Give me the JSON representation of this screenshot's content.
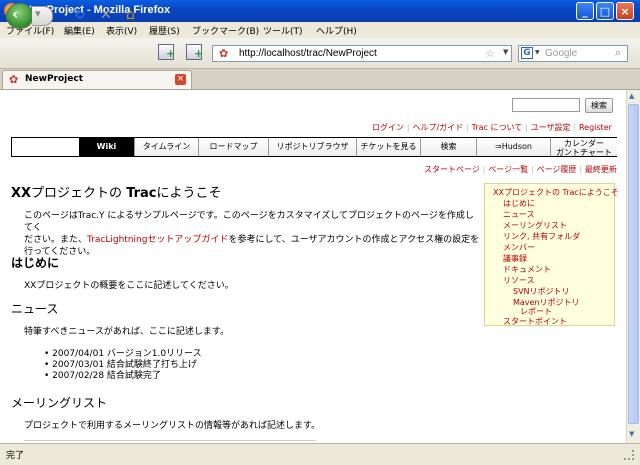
{
  "window": {
    "title": "NewProject - Mozilla Firefox",
    "minimize": "_",
    "maximize": "□",
    "close": "×"
  },
  "menu": [
    "ファイル(F)",
    "編集(E)",
    "表示(V)",
    "履歴(S)",
    "ブックマーク(B)",
    "ツール(T)",
    "ヘルプ(H)"
  ],
  "toolbar": {
    "url": "http://localhost/trac/NewProject",
    "search_placeholder": "Google",
    "back_icon": "back-arrow-icon",
    "forward_icon": "forward-arrow-icon"
  },
  "tab": {
    "label": "NewProject"
  },
  "trac": {
    "search_button": "検索",
    "metanav": [
      "ログイン",
      "ヘルプ/ガイド",
      "Trac について",
      "ユーザ設定",
      "Register"
    ],
    "mainnav": [
      "Wiki",
      "タイムライン",
      "ロードマップ",
      "リポジトリブラウザ",
      "チケットを見る",
      "検索",
      "⇒Hudson",
      "カレンダー",
      "ガントチャート"
    ],
    "ctxnav": [
      "スタートページ",
      "ページ一覧",
      "ページ履歴",
      "最終更新"
    ],
    "title_xx": "XX",
    "title_mid": "プロジェクトの ",
    "title_trac": "Trac",
    "title_end": "にようこそ",
    "intro_1": "このページはTrac.Y によるサンプルページです。このページをカスタマイズしてプロジェクトのページを作成してく",
    "intro_2a": "ださい。また、",
    "intro_2link": "TracLightningセットアップガイド",
    "intro_2b": "を参考にして、ユーザアカウントの作成とアクセス権の設定を",
    "intro_3": "行ってください。",
    "h_hajimeni": "はじめに",
    "p_hajimeni": "XXプロジェクトの概要をここに記述してください。",
    "h_news": "ニュース",
    "p_news": "特筆すべきニュースがあれば、ここに記述します。",
    "news": [
      "2007/04/01 バージョン1.0リリース",
      "2007/03/01 結合試験終了打ち上げ",
      "2007/02/28 結合試験完了"
    ],
    "h_ml": "メーリングリスト",
    "p_ml": "プロジェクトで利用するメーリングリストの情報等があれば記述します。",
    "toc": [
      "XXプロジェクトの Tracにようこそ",
      "はじめに",
      "ニュース",
      "メーリングリスト",
      "リンク, 共有フォルダ",
      "メンバー",
      "議事録",
      "ドキュメント",
      "リソース",
      "SVNリポジトリ",
      "Mavenリポジトリ",
      "レポート",
      "スタートポイント"
    ]
  },
  "status": "完了"
}
